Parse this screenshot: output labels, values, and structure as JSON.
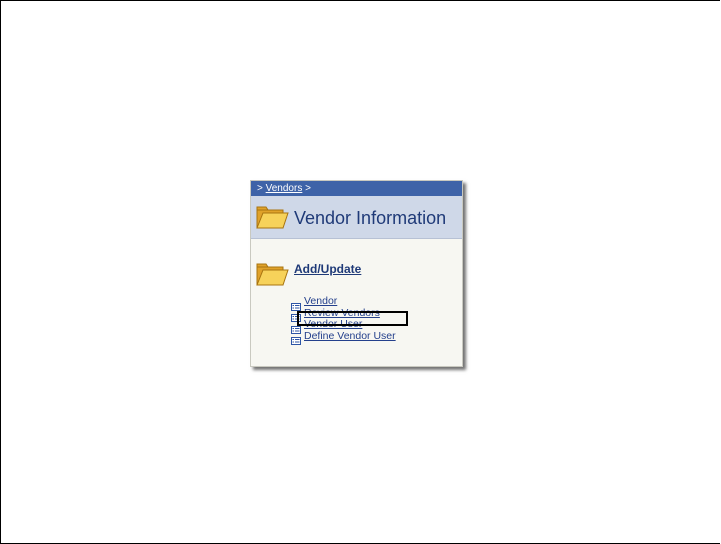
{
  "breadcrumb": {
    "prefix": ">",
    "link": "Vendors",
    "suffix": ">"
  },
  "header": {
    "title": "Vendor Information",
    "icon": "folder-icon"
  },
  "section": {
    "label": "Add/Update",
    "icon": "folder-icon"
  },
  "links": [
    {
      "label": "Vendor",
      "icon": "page-list-icon"
    },
    {
      "label": "Review Vendors",
      "icon": "page-list-icon"
    },
    {
      "label": "Vendor User",
      "icon": "page-list-icon"
    },
    {
      "label": "Define Vendor User",
      "icon": "page-list-icon"
    }
  ],
  "colors": {
    "breadcrumb_bg": "#3e63a8",
    "header_bg": "#cfd8e8",
    "title": "#1f3a78",
    "link": "#24408c",
    "folder": "#f2c23a"
  },
  "highlighted_link": "Review Vendors"
}
